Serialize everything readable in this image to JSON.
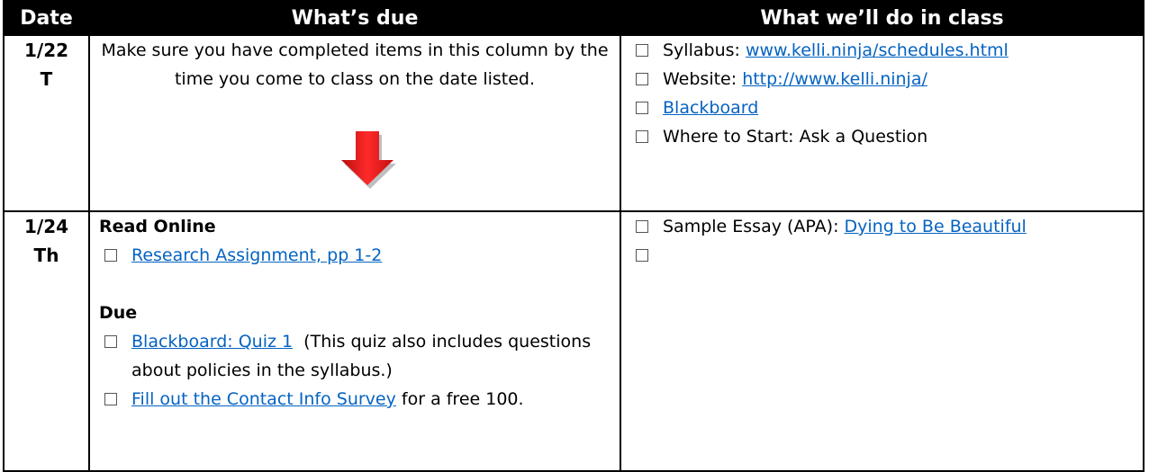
{
  "header": {
    "date": "Date",
    "due": "What’s due",
    "class": "What we’ll do in class"
  },
  "rows": [
    {
      "date": "1/22",
      "day": "T",
      "due_intro": "Make sure you have completed items in this column by the time you come to class on the date listed.",
      "class_items": [
        {
          "label": "Syllabus: ",
          "link": "www.kelli.ninja/schedules.html"
        },
        {
          "label": "Website: ",
          "link": "http://www.kelli.ninja/"
        },
        {
          "link": "Blackboard"
        },
        {
          "label": "Where to Start: Ask a Question"
        }
      ]
    },
    {
      "date": "1/24",
      "day": "Th",
      "read_heading": "Read Online",
      "read_item_link": "Research Assignment, pp 1-2",
      "due_heading": "Due",
      "due_items": [
        {
          "link": "Blackboard: Quiz 1",
          "suffix": "  (This quiz also includes questions about policies in the syllabus.)"
        },
        {
          "link": "Fill out the Contact Info Survey",
          "suffix": " for a free 100."
        }
      ],
      "class_items": [
        {
          "label": "Sample Essay (APA): ",
          "link": "Dying to Be Beautiful"
        },
        {
          "label": ""
        }
      ]
    }
  ],
  "colors": {
    "header_bg": "#000000",
    "header_text": "#ffffff",
    "link": "#0563c1",
    "arrow": "#e31b1b"
  },
  "icons": {
    "checkbox": "checkbox-icon",
    "arrow": "arrow-down-icon"
  }
}
